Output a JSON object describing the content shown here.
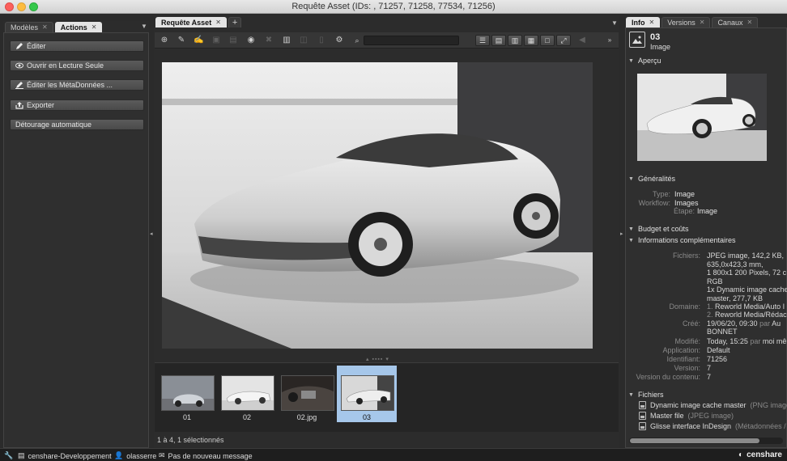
{
  "window": {
    "title": "Requête Asset (IDs: , 71257, 71258, 77534, 71256)"
  },
  "left_panel": {
    "tabs": [
      {
        "label": "Modèles",
        "active": false
      },
      {
        "label": "Actions",
        "active": true
      }
    ],
    "actions": [
      {
        "label": "Éditer",
        "icon": "pencil-icon"
      },
      {
        "label": "Ouvrir en Lecture Seule",
        "icon": "eye-icon"
      },
      {
        "label": "Éditer les MétaDonnées ...",
        "icon": "edit-metadata-icon"
      },
      {
        "label": "Exporter",
        "icon": "export-icon"
      },
      {
        "label": "Détourage automatique",
        "icon": ""
      }
    ]
  },
  "center_panel": {
    "tabs": [
      {
        "label": "Requête Asset",
        "active": true
      }
    ],
    "add_tab_label": "+",
    "search": {
      "value": "",
      "placeholder": ""
    },
    "thumbnails": [
      {
        "label": "01",
        "selected": false
      },
      {
        "label": "02",
        "selected": false
      },
      {
        "label": "02.jpg",
        "selected": false
      },
      {
        "label": "03",
        "selected": true
      }
    ],
    "status": "1 à 4, 1 sélectionnés"
  },
  "right_panel": {
    "tabs": [
      {
        "label": "Info",
        "active": true
      },
      {
        "label": "Versions",
        "active": false
      },
      {
        "label": "Canaux",
        "active": false
      }
    ],
    "asset": {
      "name": "03",
      "type": "Image"
    },
    "sections": {
      "apercu": "Aperçu",
      "generalites": "Généralités",
      "budget": "Budget et coûts",
      "infos": "Informations complémentaires",
      "fichiers": "Fichiers"
    },
    "generalites": [
      {
        "key": "Type:",
        "value": "Image"
      },
      {
        "key": "Workflow:",
        "value": "Images"
      },
      {
        "key": "Étape:",
        "value": "Image"
      }
    ],
    "infos": {
      "fichiers_key": "Fichiers:",
      "fichiers_lines": [
        "JPEG image, 142,2 KB,",
        "635,0x423,3 mm,",
        "1 800x1 200 Pixels, 72 c",
        "RGB",
        "1x Dynamic image cache",
        "master, 277,7 KB"
      ],
      "domaine_key": "Domaine:",
      "domaine_lines": [
        {
          "num": "1.",
          "text": "Reworld Media/Auto I"
        },
        {
          "num": "2.",
          "text": "Reworld Media/Rédac"
        }
      ],
      "cree_key": "Créé:",
      "cree_value": "19/06/20, 09:30",
      "cree_par": "par",
      "cree_user": "Au",
      "cree_user2": "BONNET",
      "modifie_key": "Modifié:",
      "modifie_value": "Today, 15:25",
      "modifie_par": "par",
      "modifie_user": "moi mê",
      "application_key": "Application:",
      "application_value": "Default",
      "identifiant_key": "Identifiant:",
      "identifiant_value": "71256",
      "version_key": "Version:",
      "version_value": "7",
      "version_contenu_key": "Version du contenu:",
      "version_contenu_value": "7"
    },
    "files": [
      {
        "name": "Dynamic image cache master",
        "detail": "(PNG image"
      },
      {
        "name": "Master file",
        "detail": "(JPEG image)"
      },
      {
        "name": "Glisse interface InDesign",
        "detail": "(Métadonnées /"
      }
    ]
  },
  "statusbar": {
    "server": "censhare-Developpement",
    "user": "olasserre",
    "messages": "Pas de nouveau message",
    "brand": "censhare"
  },
  "colors": {
    "active_tab": "#e4e4e4",
    "selection": "#a6c7ea",
    "panel_bg": "#2f2f2f"
  }
}
